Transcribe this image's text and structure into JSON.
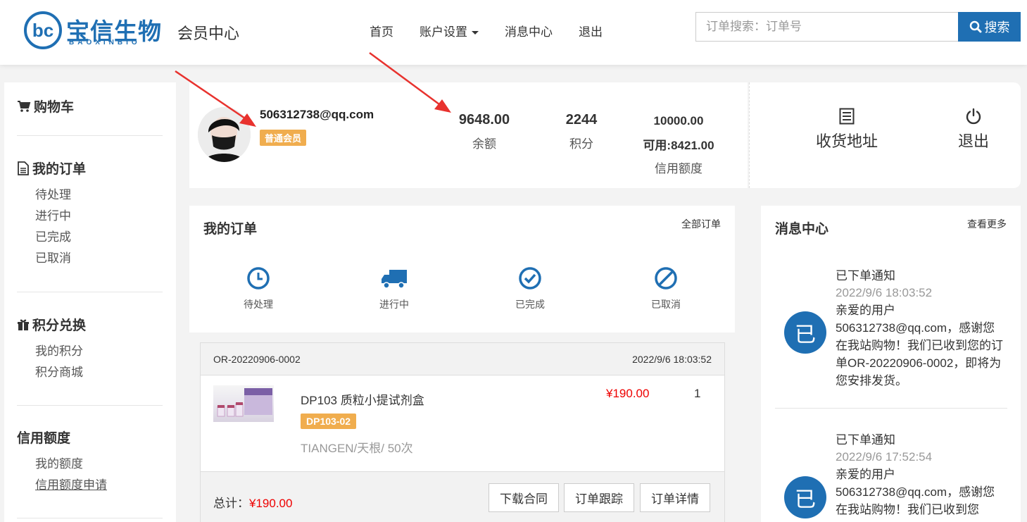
{
  "header": {
    "logo_text": "宝信生物",
    "logo_sub": "BAOXINBIO",
    "member_center": "会员中心",
    "nav": {
      "home": "首页",
      "account_settings": "账户设置",
      "message_center": "消息中心",
      "logout": "退出"
    },
    "search_placeholder": "订单搜索：订单号",
    "search_button": "搜索"
  },
  "sidebar": {
    "cart": "购物车",
    "orders": {
      "title": "我的订单",
      "items": [
        "待处理",
        "进行中",
        "已完成",
        "已取消"
      ]
    },
    "points": {
      "title": "积分兑换",
      "items": [
        "我的积分",
        "积分商城"
      ]
    },
    "credit": {
      "title": "信用额度",
      "items": [
        "我的额度",
        "信用额度申请"
      ]
    }
  },
  "profile": {
    "email": "506312738@qq.com",
    "level": "普通会员",
    "balance": "9648.00",
    "balance_label": "余额",
    "points": "2244",
    "points_label": "积分",
    "credit_total": "10000.00",
    "credit_available": "可用:8421.00",
    "credit_label": "信用额度"
  },
  "quick": {
    "address": "收货地址",
    "logout": "退出"
  },
  "orders_panel": {
    "title": "我的订单",
    "all_orders": "全部订单",
    "statuses": [
      "待处理",
      "进行中",
      "已完成",
      "已取消"
    ]
  },
  "order": {
    "number": "OR-20220906-0002",
    "time": "2022/9/6 18:03:52",
    "product_name": "DP103 质粒小提试剂盒",
    "sku": "DP103-02",
    "brand": "TIANGEN/天根/ 50次",
    "price": "¥190.00",
    "qty": "1",
    "total_label": "总计：",
    "total": "¥190.00",
    "btn_contract": "下载合同",
    "btn_track": "订单跟踪",
    "btn_detail": "订单详情"
  },
  "messages": {
    "title": "消息中心",
    "more": "查看更多",
    "avatar_char": "已",
    "items": [
      {
        "title": "已下单通知",
        "time": "2022/9/6 18:03:52",
        "body": "亲爱的用户506312738@qq.com，感谢您在我站购物！我们已收到您的订单OR-20220906-0002，即将为您安排发货。"
      },
      {
        "title": "已下单通知",
        "time": "2022/9/6 17:52:54",
        "body": "亲爱的用户506312738@qq.com，感谢您在我站购物！我们已收到您"
      }
    ]
  },
  "colors": {
    "brand": "#1f6fb3",
    "badge": "#f0ad4e",
    "price": "#e00000",
    "annotation_arrow": "#e8322e"
  }
}
